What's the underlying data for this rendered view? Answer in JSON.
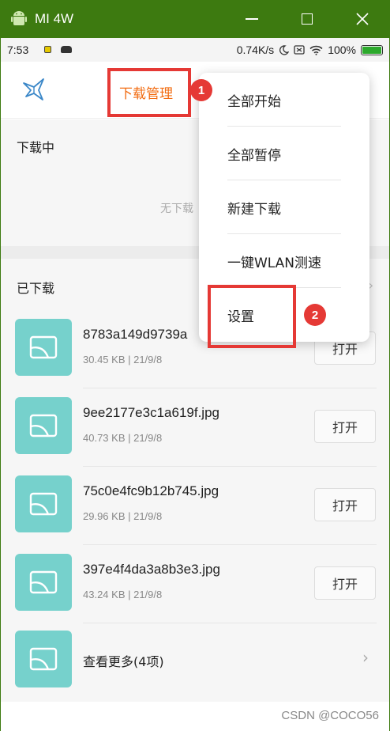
{
  "window": {
    "title": "MI 4W"
  },
  "status_bar": {
    "time": "7:53",
    "net_speed": "0.74K/s",
    "battery": "100%"
  },
  "header": {
    "title": "下载管理"
  },
  "downloading": {
    "label": "下载中",
    "empty_text": "无下载"
  },
  "downloaded": {
    "label": "已下载",
    "files": [
      {
        "name": "8783a149d9739a",
        "meta": "30.45 KB | 21/9/8",
        "open_label": "打开"
      },
      {
        "name": "9ee2177e3c1a619f.jpg",
        "meta": "40.73 KB | 21/9/8",
        "open_label": "打开"
      },
      {
        "name": "75c0e4fc9b12b745.jpg",
        "meta": "29.96 KB | 21/9/8",
        "open_label": "打开"
      },
      {
        "name": "397e4f4da3a8b3e3.jpg",
        "meta": "43.24 KB | 21/9/8",
        "open_label": "打开"
      }
    ],
    "more_label": "查看更多(4项)"
  },
  "menu": {
    "items": [
      {
        "label": "全部开始"
      },
      {
        "label": "全部暂停"
      },
      {
        "label": "新建下载"
      },
      {
        "label": "一键WLAN测速"
      },
      {
        "label": "设置"
      }
    ]
  },
  "annotations": {
    "badge1": "1",
    "badge2": "2"
  },
  "watermark": "CSDN @COCO56",
  "colors": {
    "titlebar": "#3d7a10",
    "accent": "#f26c12",
    "thumb": "#76d1cc",
    "annotation": "#e53935"
  }
}
